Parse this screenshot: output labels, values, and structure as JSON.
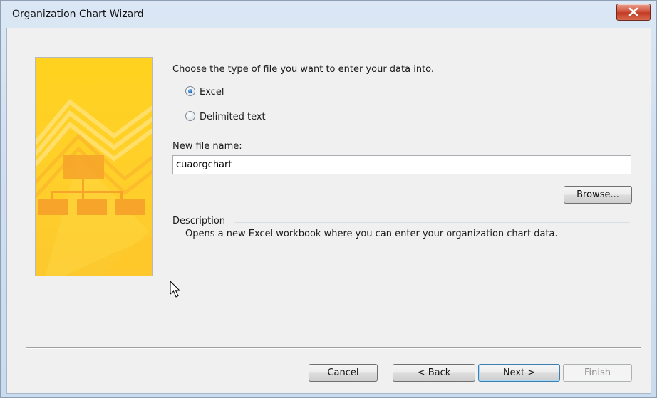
{
  "window": {
    "title": "Organization Chart Wizard",
    "close_label": "X"
  },
  "wizard": {
    "prompt": "Choose the type of file you want to enter your data into.",
    "options": [
      {
        "label": "Excel",
        "checked": true
      },
      {
        "label": "Delimited text",
        "checked": false
      }
    ],
    "file_name_label": "New file name:",
    "file_name_value": "cuaorgchart",
    "browse_label": "Browse...",
    "description_title": "Description",
    "description_text": "Opens a new Excel workbook where you can enter your organization chart data."
  },
  "footer": {
    "cancel_label": "Cancel",
    "back_label": "< Back",
    "next_label": "Next >",
    "finish_label": "Finish"
  },
  "colors": {
    "banner_yellow": "#ffd21f",
    "banner_orange": "#f7a51f",
    "accent_blue": "#3c7fb1"
  },
  "icons": [
    "close-icon",
    "org-chart-banner",
    "mouse-cursor-icon"
  ]
}
